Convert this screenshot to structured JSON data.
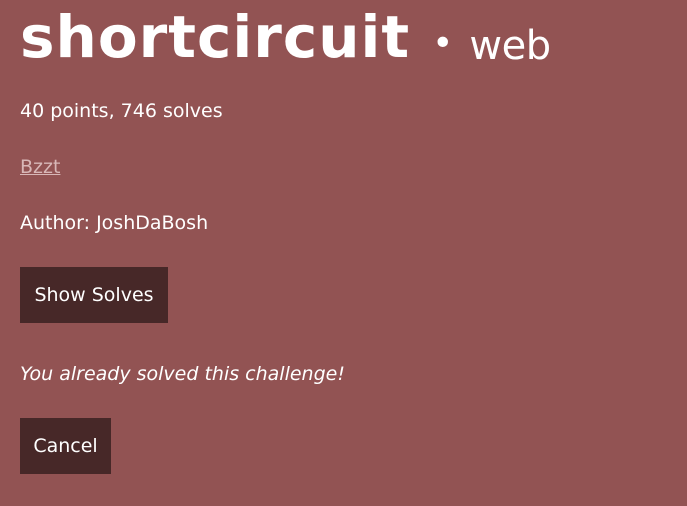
{
  "challenge": {
    "name": "shortcircuit",
    "separator": "•",
    "category": "web",
    "meta": "40 points, 746 solves",
    "link_text": "Bzzt",
    "author": "Author: JoshDaBosh",
    "solved_message": "You already solved this challenge!"
  },
  "buttons": {
    "show_solves": "Show Solves",
    "cancel": "Cancel"
  },
  "colors": {
    "background": "#925353",
    "button": "#472828",
    "text": "#ffffff",
    "link": "#d8b7b7"
  }
}
